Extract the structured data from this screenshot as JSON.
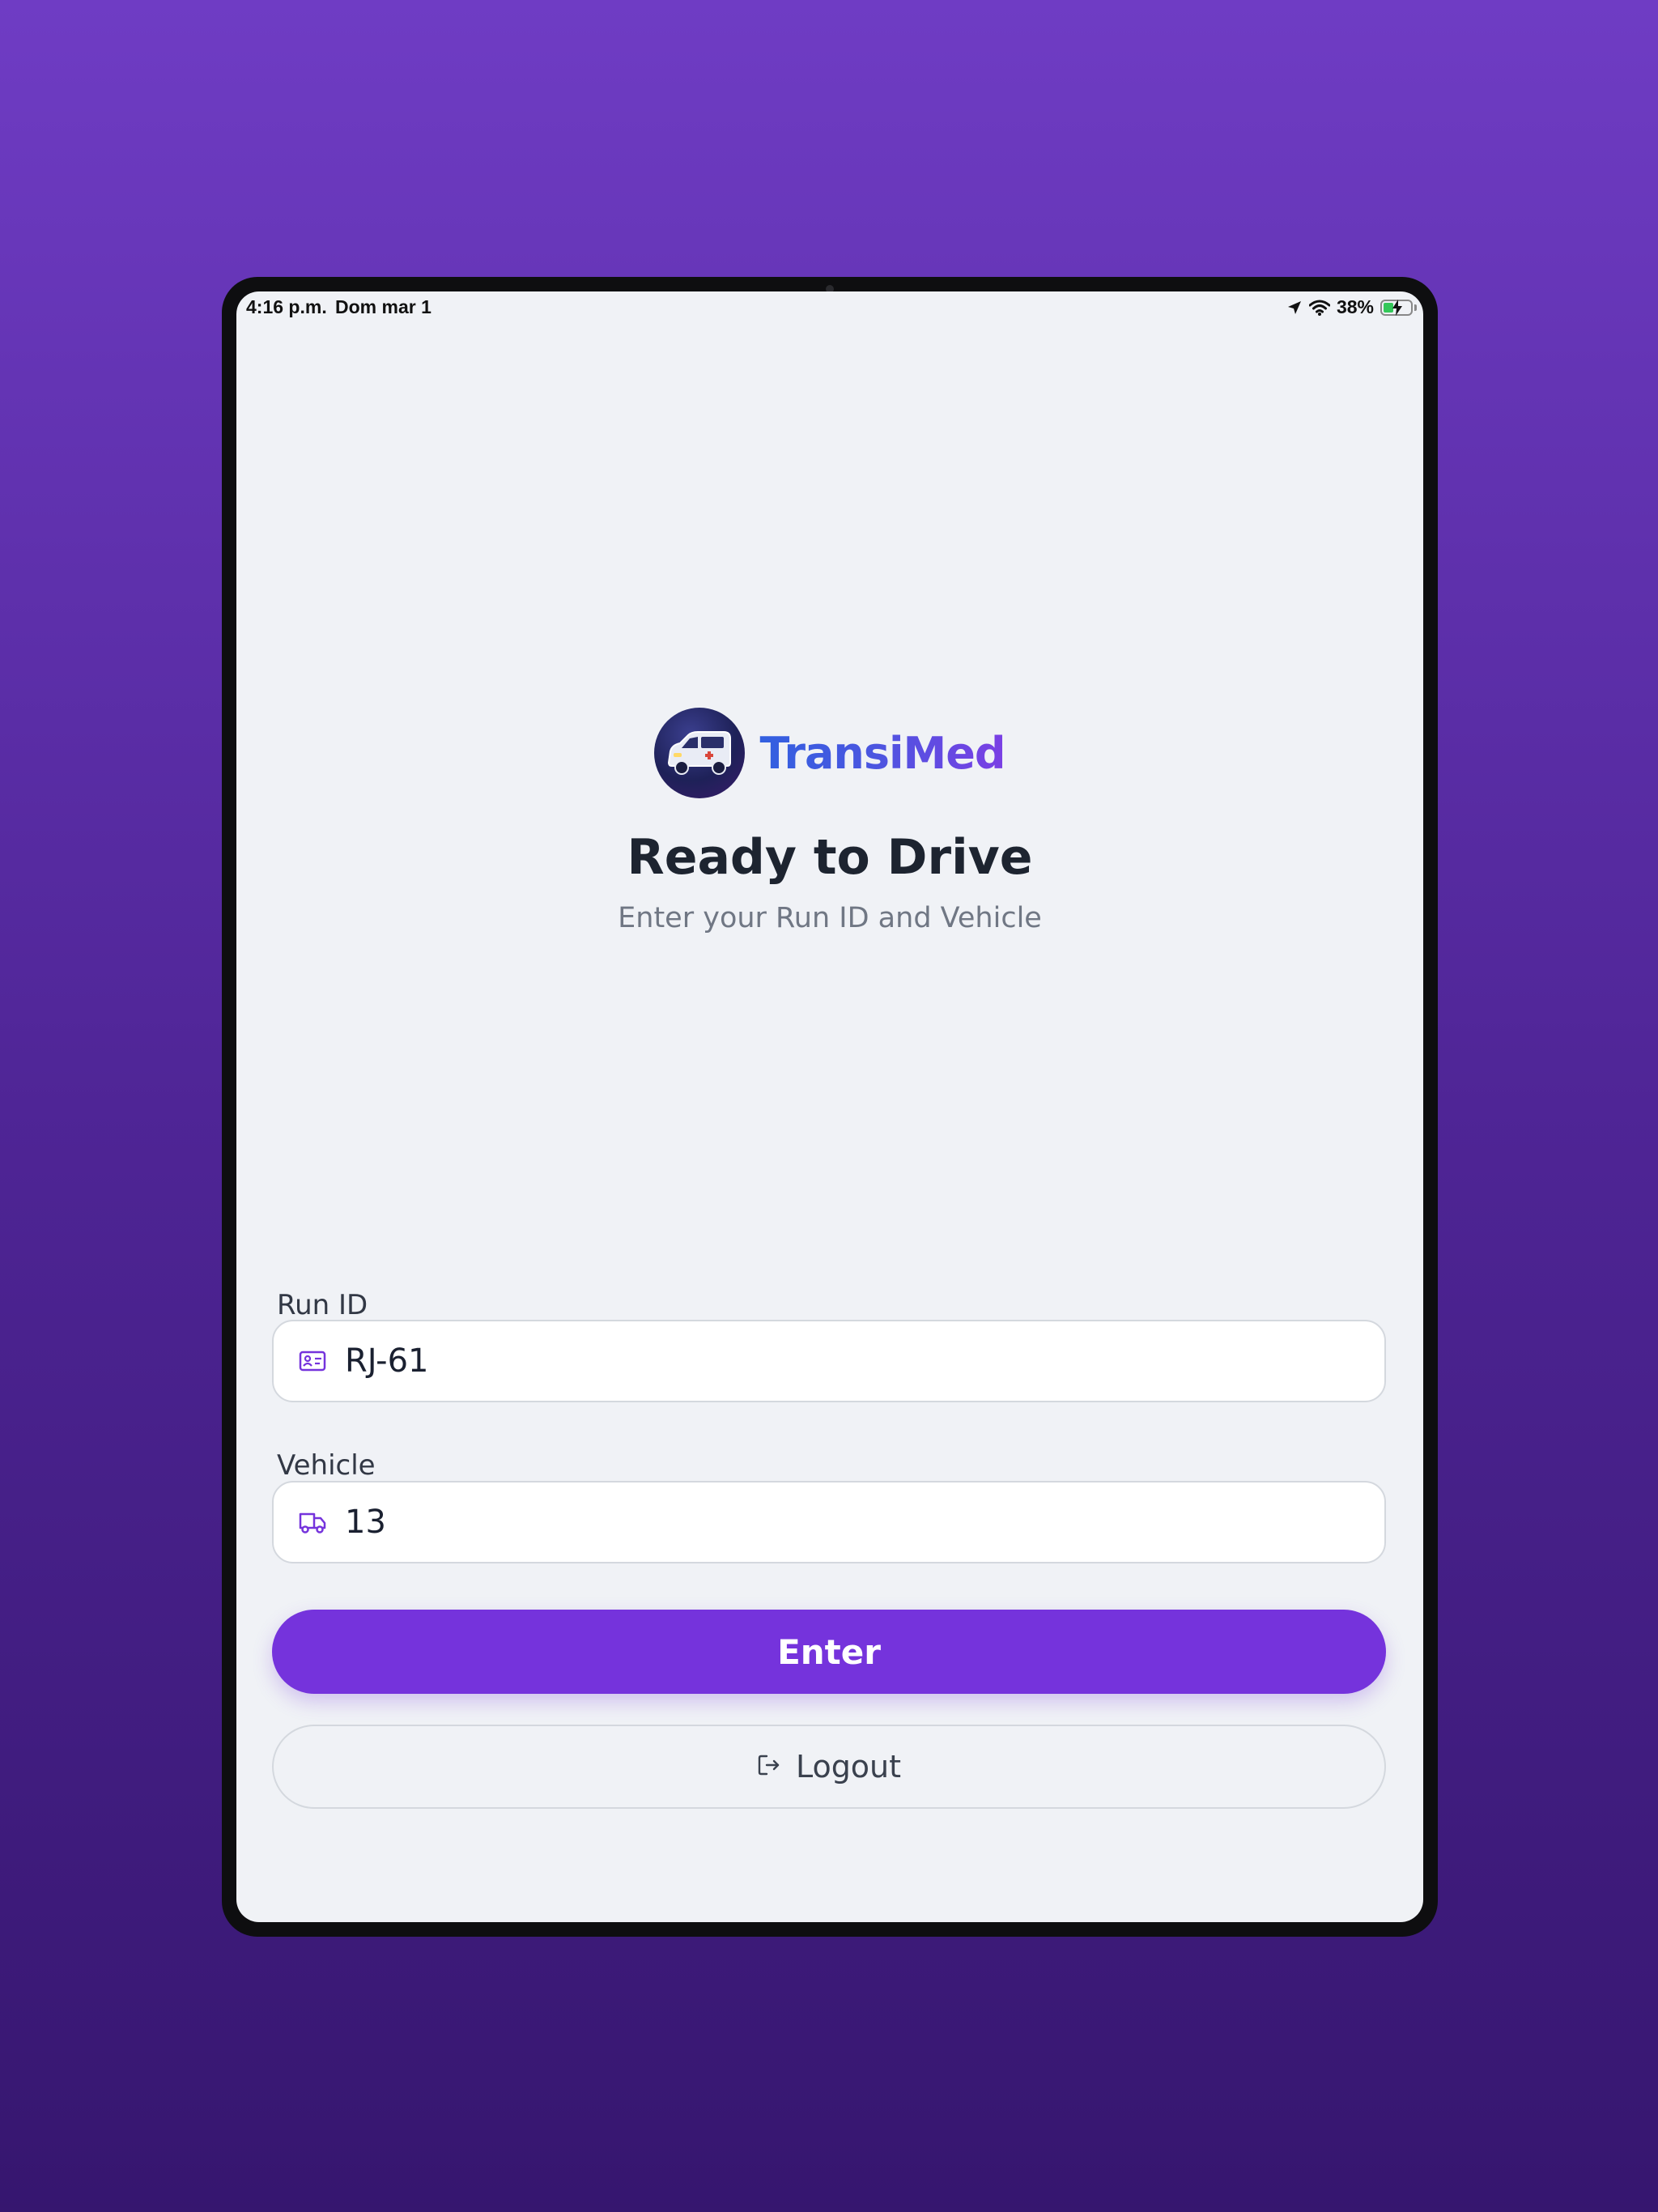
{
  "status_bar": {
    "time": "4:16 p.m.",
    "date": "Dom mar 1",
    "battery": "38%",
    "battery_level": 0.38,
    "icons": [
      "location-arrow-icon",
      "wifi-icon",
      "battery-charging-icon"
    ]
  },
  "brand": {
    "name": "TransiMed",
    "logo_icon": "ambulance-van-icon"
  },
  "header": {
    "title": "Ready to Drive",
    "subtitle": "Enter your Run ID and Vehicle"
  },
  "form": {
    "run_id": {
      "label": "Run ID",
      "value": "RJ-61",
      "icon": "id-card-icon"
    },
    "vehicle": {
      "label": "Vehicle",
      "value": "13",
      "icon": "truck-icon"
    }
  },
  "actions": {
    "enter_label": "Enter",
    "logout_label": "Logout",
    "logout_icon": "logout-icon"
  },
  "colors": {
    "accent": "#7533dc",
    "background_top": "#6f3cc4",
    "background_bottom": "#36166f",
    "screen_bg": "#f0f2f6"
  }
}
